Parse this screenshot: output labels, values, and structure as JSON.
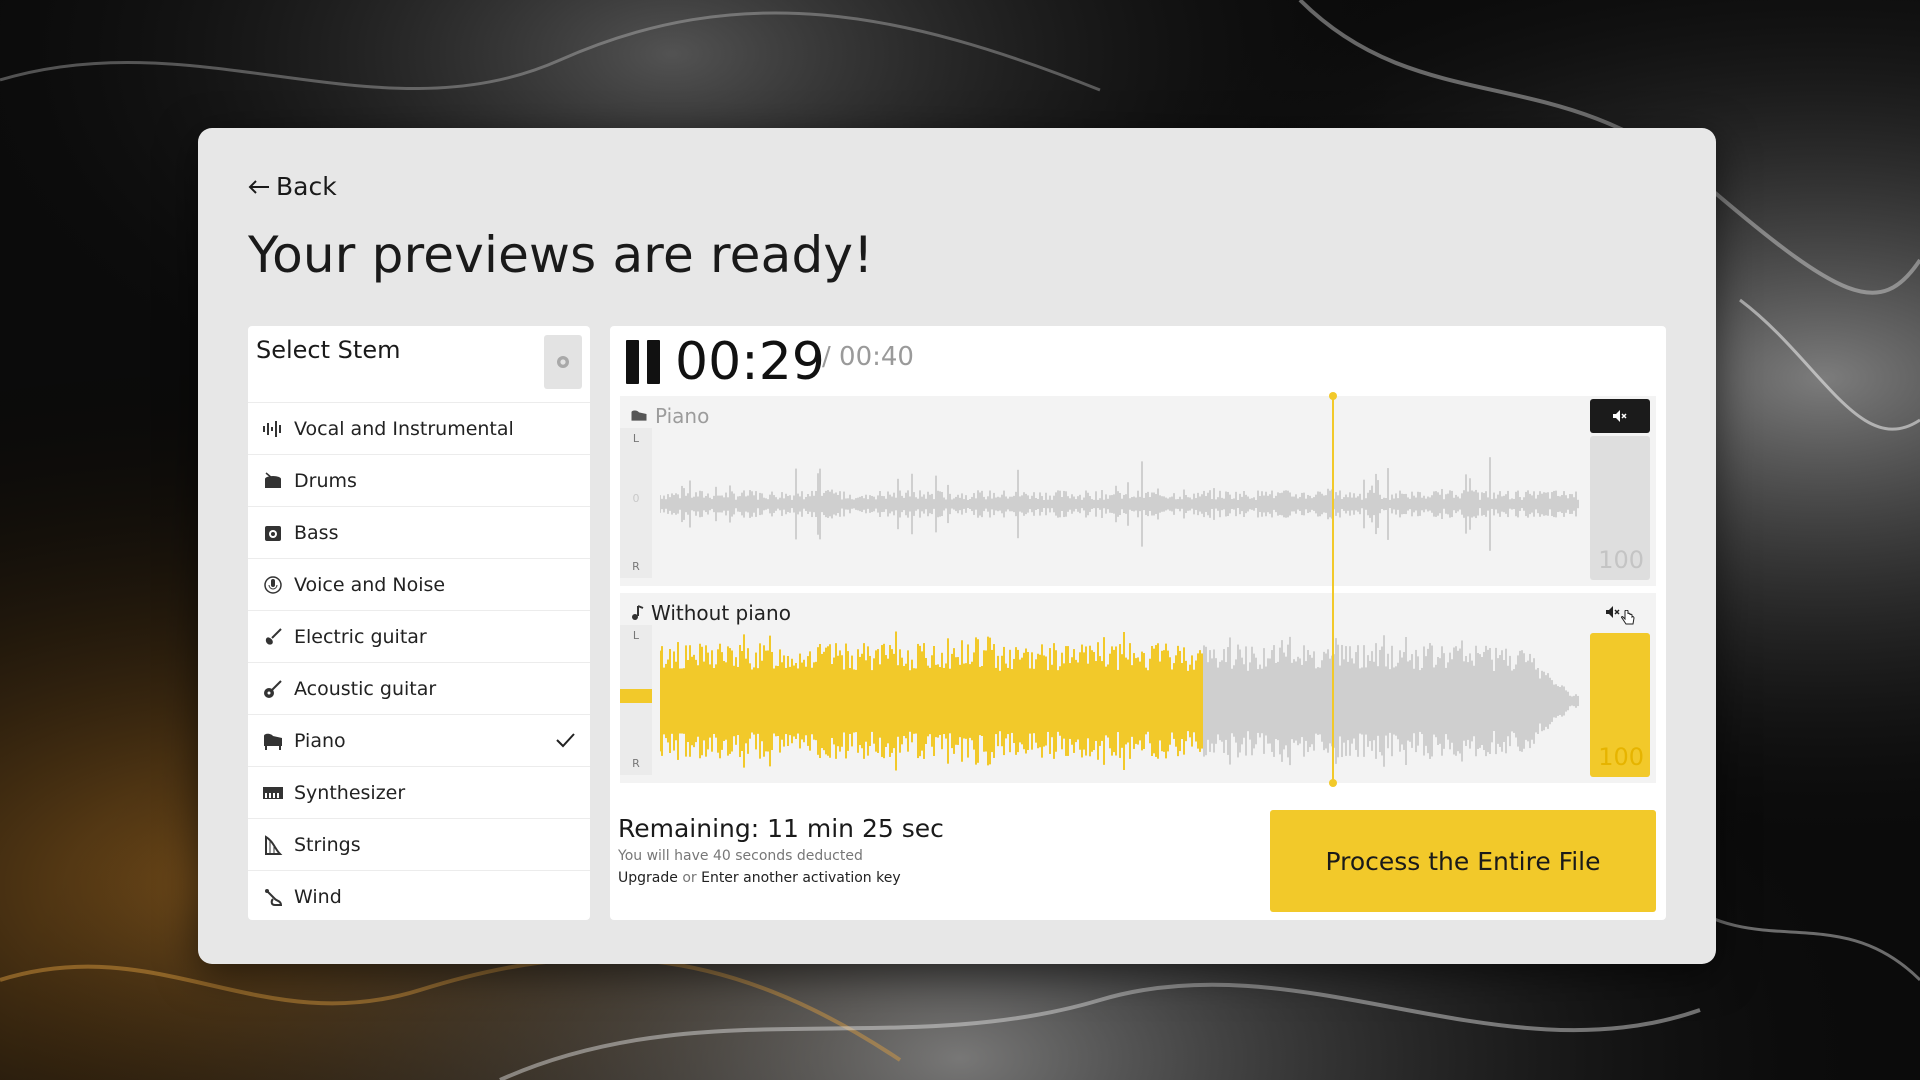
{
  "header": {
    "back_label": "Back",
    "title": "Your previews are ready!"
  },
  "stems": {
    "heading": "Select Stem",
    "items": [
      {
        "label": "Vocal and Instrumental",
        "icon": "waveform-icon"
      },
      {
        "label": "Drums",
        "icon": "drum-icon"
      },
      {
        "label": "Bass",
        "icon": "amp-icon"
      },
      {
        "label": "Voice and Noise",
        "icon": "microphone-icon"
      },
      {
        "label": "Electric guitar",
        "icon": "electric-guitar-icon"
      },
      {
        "label": "Acoustic guitar",
        "icon": "acoustic-guitar-icon"
      },
      {
        "label": "Piano",
        "icon": "piano-icon",
        "selected": true
      },
      {
        "label": "Synthesizer",
        "icon": "synth-keyboard-icon"
      },
      {
        "label": "Strings",
        "icon": "harp-icon"
      },
      {
        "label": "Wind",
        "icon": "wind-instrument-icon"
      }
    ]
  },
  "player": {
    "current_time": "00:29",
    "total_time": "/ 00:40",
    "tracks": [
      {
        "name": "Piano",
        "icon": "piano-icon",
        "muted": true,
        "volume": "100",
        "channel_l": "L",
        "channel_zero": "0",
        "channel_r": "R"
      },
      {
        "name": "Without piano",
        "icon": "music-note-icon",
        "muted": false,
        "volume": "100",
        "channel_l": "L",
        "channel_zero": "0",
        "channel_r": "R"
      }
    ],
    "progress_fraction": 0.725
  },
  "footer": {
    "remaining": "Remaining: 11 min 25 sec",
    "deduct_note": "You will have 40 seconds deducted",
    "upgrade_label": "Upgrade",
    "or_text": "or",
    "activation_label": "Enter another activation key",
    "process_label": "Process the Entire File"
  },
  "colors": {
    "accent": "#f2c92a",
    "panel": "#e7e7e7",
    "waveform_grey": "#cfcfcf"
  }
}
